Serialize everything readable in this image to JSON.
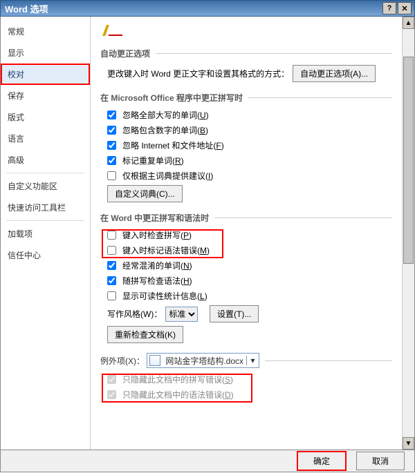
{
  "titlebar": {
    "title": "Word 选项"
  },
  "sidebar": {
    "items": [
      {
        "label": "常规"
      },
      {
        "label": "显示"
      },
      {
        "label": "校对",
        "selected": true,
        "highlight": true
      },
      {
        "label": "保存"
      },
      {
        "label": "版式"
      },
      {
        "label": "语言"
      },
      {
        "label": "高级"
      },
      {
        "sep": true
      },
      {
        "label": "自定义功能区"
      },
      {
        "label": "快速访问工具栏"
      },
      {
        "sep": true
      },
      {
        "label": "加载项"
      },
      {
        "label": "信任中心"
      }
    ]
  },
  "content": {
    "section1_title": "自动更正选项",
    "section1_text": "更改键入时 Word 更正文字和设置其格式的方式：",
    "autocorrect_btn": "自动更正选项(A)...",
    "section2_title": "在 Microsoft Office 程序中更正拼写时",
    "opts2": [
      {
        "label": "忽略全部大写的单词(U)",
        "checked": true
      },
      {
        "label": "忽略包含数字的单词(B)",
        "checked": true
      },
      {
        "label": "忽略 Internet 和文件地址(F)",
        "checked": true
      },
      {
        "label": "标记重复单词(R)",
        "checked": true
      },
      {
        "label": "仅根据主词典提供建议(I)",
        "checked": false
      }
    ],
    "custom_dict_btn": "自定义词典(C)...",
    "section3_title": "在 Word 中更正拼写和语法时",
    "opts3": [
      {
        "label": "键入时检查拼写(P)",
        "checked": false
      },
      {
        "label": "键入时标记语法错误(M)",
        "checked": false
      },
      {
        "label": "经常混淆的单词(N)",
        "checked": true
      },
      {
        "label": "随拼写检查语法(H)",
        "checked": true
      },
      {
        "label": "显示可读性统计信息(L)",
        "checked": false
      }
    ],
    "style_label": "写作风格(W)：",
    "style_value": "标准",
    "settings_btn": "设置(T)...",
    "recheck_btn": "重新检查文档(K)",
    "exceptions_label": "例外项(X)：",
    "exceptions_value": "网站金字塔结构.docx",
    "opts4": [
      {
        "label": "只隐藏此文档中的拼写错误(S)",
        "checked": true
      },
      {
        "label": "只隐藏此文档中的语法错误(D)",
        "checked": true
      }
    ]
  },
  "footer": {
    "ok": "确定",
    "cancel": "取消"
  }
}
